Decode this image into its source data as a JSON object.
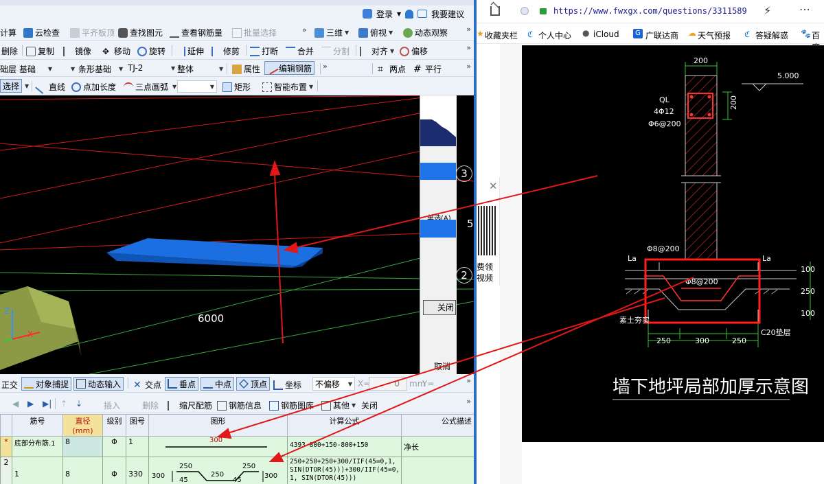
{
  "topbar": {
    "login": "登录",
    "suggest": "我要建议"
  },
  "toolbar1": [
    "计算",
    "云检查",
    "平齐板顶",
    "查找图元",
    "查看钢筋量",
    "批量选择",
    "三维",
    "俯视",
    "动态观察"
  ],
  "toolbar2": [
    "删除",
    "复制",
    "镜像",
    "移动",
    "旋转",
    "延伸",
    "修剪",
    "打断",
    "合并",
    "分割",
    "对齐",
    "偏移"
  ],
  "toolbar3": {
    "floor": "础层",
    "type1": "基础",
    "type2": "条形基础",
    "code": "TJ-2",
    "whole": "整体",
    "props": "属性",
    "edit_rebar": "编辑钢筋",
    "two_points": "两点",
    "parallel": "平行"
  },
  "toolbar4": {
    "select": "选择",
    "line": "直线",
    "point_len": "点加长度",
    "arc": "三点画弧",
    "rect": "矩形",
    "smart": "智能布置"
  },
  "cad": {
    "dim_6000": "6000",
    "axis_3": "3",
    "axis_2": "2",
    "axis_5": "5",
    "panel_text": "单选(A)",
    "close": "关闭",
    "cancel": "取消"
  },
  "snapbar": {
    "ortho": "正交",
    "snap": "对象捕捉",
    "dyn": "动态输入",
    "intersect": "交点",
    "perp": "垂点",
    "mid": "中点",
    "vertex": "顶点",
    "coord": "坐标",
    "offset": "不偏移",
    "x_label": "X=",
    "x_value": "0",
    "unit": "mm",
    "y_label": "Y="
  },
  "rebarbar": {
    "insert": "插入",
    "delete": "删除",
    "scale": "缩尺配筋",
    "info": "钢筋信息",
    "lib": "钢筋图库",
    "other": "其他",
    "close": "关闭"
  },
  "table": {
    "headers": [
      "筋号",
      "直径(mm)",
      "级别",
      "图号",
      "图形",
      "计算公式",
      "公式描述"
    ],
    "row1": {
      "marker": "*",
      "name": "底部分布筋.1",
      "dia": "8",
      "grade": "Φ",
      "fig": "1",
      "shape_len": "300",
      "formula": "4393-800+150-800+150",
      "desc": "净长"
    },
    "row2": {
      "marker": "2",
      "name": "1",
      "dia": "8",
      "grade": "Φ",
      "fig": "330",
      "d_left": "300",
      "d_top1": "250",
      "d_top2": "250",
      "d_mid": "250",
      "d_a1": "45",
      "d_a2": "45",
      "d_right": "300",
      "formula": "250+250+250+300/IIF(45=0,1, SIN(DTOR(45)))+300/IIF(45=0, 1, SIN(DTOR(45)))"
    }
  },
  "browser": {
    "url": "https://www.fwxgx.com/questions/3311589"
  },
  "bookmarks": [
    "收藏夹栏",
    "个人中心",
    "iCloud",
    "广联达商",
    "天气预报",
    "答疑解惑",
    "百度"
  ],
  "side_ad": {
    "line1": "费领",
    "line2": "视频"
  },
  "drawing": {
    "dim_200_top": "200",
    "level": "5.000",
    "ql": "QL",
    "ql_bars": "4Φ12",
    "ql_stirrup": "Φ6@200",
    "dim_200_side": "200",
    "la_left": "La",
    "la_right": "La",
    "phi8_top": "Φ8@200",
    "phi8_mid": "Φ8@200",
    "dim_100a": "100",
    "dim_250": "250",
    "dim_100b": "100",
    "soil": "素土夯实",
    "concrete": "C20垫层",
    "bot_250a": "250",
    "bot_300": "300",
    "bot_250b": "250",
    "title": "墙下地坪局部加厚示意图"
  }
}
